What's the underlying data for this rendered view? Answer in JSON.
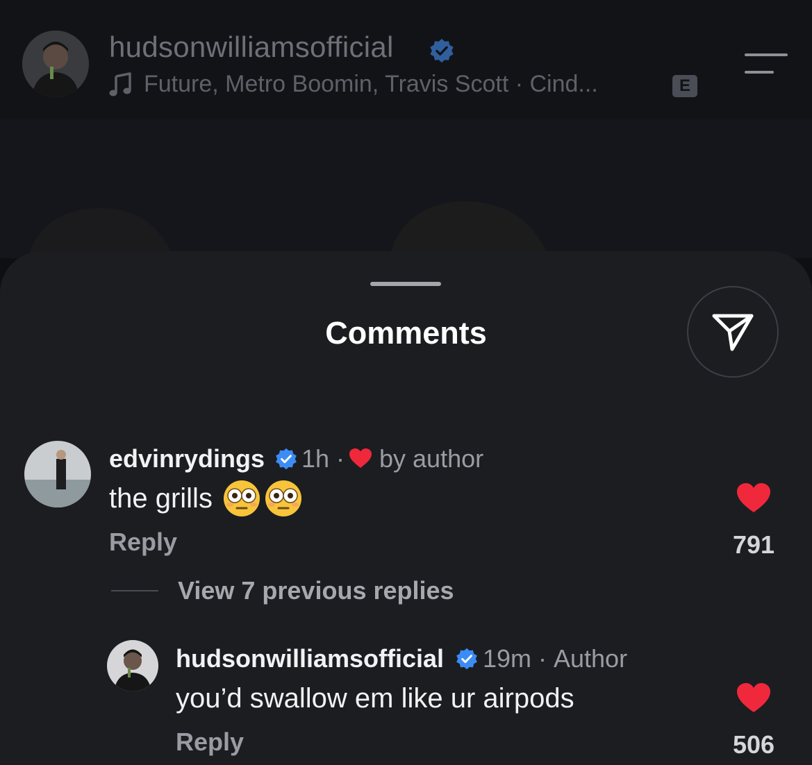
{
  "header": {
    "username": "hudsonwilliamsofficial",
    "music": "Future, Metro Boomin, Travis Scott · Cind...",
    "explicit_badge": "E",
    "icons": {
      "verified": "verified-badge-icon",
      "music": "music-note-icon",
      "menu": "menu-icon"
    }
  },
  "sheet": {
    "title": "Comments",
    "share_icon": "send-icon"
  },
  "comments": [
    {
      "username": "edvinrydings",
      "time": "1h ·",
      "liked_by_author": "by author",
      "text": "the grills",
      "emoji": "flushed-face",
      "reply_label": "Reply",
      "likes": "791"
    }
  ],
  "replies": {
    "view_label": "View 7 previous replies",
    "items": [
      {
        "username": "hudsonwilliamsofficial",
        "time": "19m ·",
        "badge": "Author",
        "text": "you’d swallow em like ur airpods",
        "reply_label": "Reply",
        "likes": "506"
      }
    ]
  },
  "colors": {
    "verified_blue": "#3b8cf5",
    "like_red": "#f0283c",
    "sheet_bg": "#1c1d21"
  }
}
